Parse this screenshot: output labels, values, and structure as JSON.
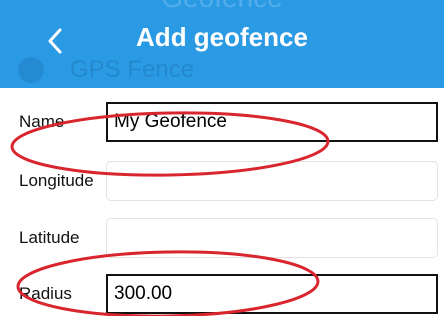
{
  "header": {
    "back_icon": "chevron-left-icon",
    "title": "Add geofence",
    "background_color": "#2b9ae5"
  },
  "background_screen": {
    "title": "Geofence",
    "item_label": "GPS Fence"
  },
  "form": {
    "name": {
      "label": "Name",
      "value": "My Geofence"
    },
    "longitude": {
      "label": "Longitude",
      "value": ""
    },
    "latitude": {
      "label": "Latitude",
      "value": ""
    },
    "radius": {
      "label": "Radius",
      "value": "300.00"
    }
  },
  "annotation": {
    "color": "#d9262e",
    "shape": "ellipse"
  }
}
